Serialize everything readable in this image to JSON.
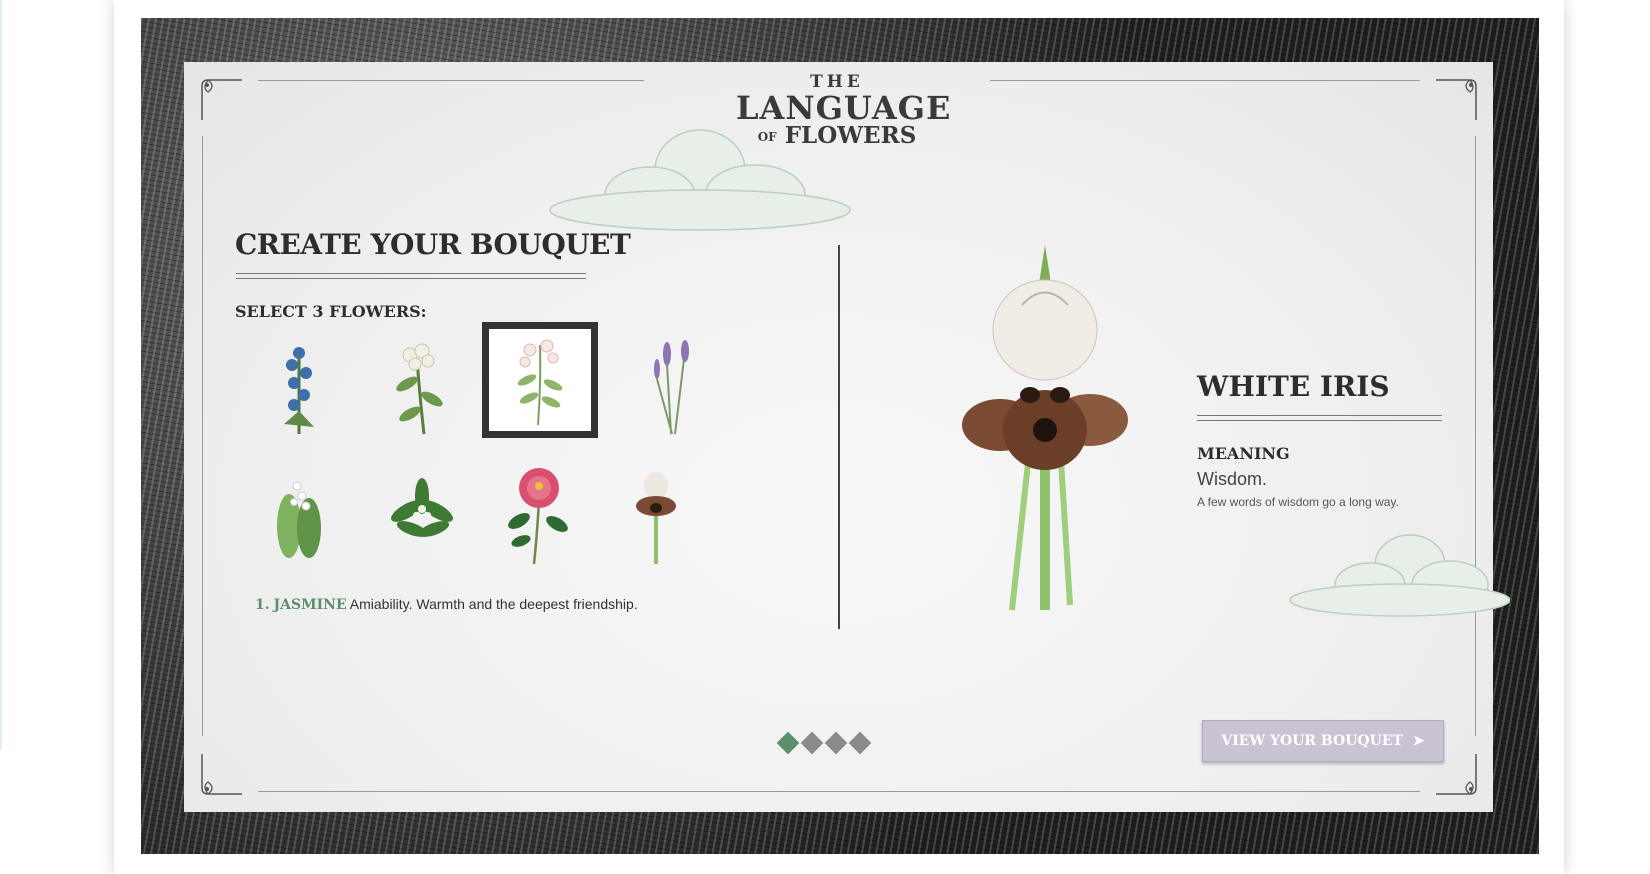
{
  "logo": {
    "line1": "THE",
    "line2": "LANGUAGE",
    "line3_small": "OF",
    "line3": "FLOWERS"
  },
  "builder": {
    "title": "CREATE YOUR BOUQUET",
    "subtitle": "SELECT 3 FLOWERS:",
    "flowers": [
      {
        "icon": "blue-larkspur-flower-icon",
        "selected": false
      },
      {
        "icon": "white-cluster-flower-icon",
        "selected": false
      },
      {
        "icon": "jasmine-flower-icon",
        "selected": true
      },
      {
        "icon": "lavender-flower-icon",
        "selected": false
      },
      {
        "icon": "lily-of-the-valley-flower-icon",
        "selected": false
      },
      {
        "icon": "green-leafy-flower-icon",
        "selected": false
      },
      {
        "icon": "pink-rose-flower-icon",
        "selected": false
      },
      {
        "icon": "white-iris-flower-icon",
        "selected": false
      }
    ],
    "status_number": "1.",
    "status_name": "JASMINE",
    "status_meaning": "Amiability. Warmth and the deepest friendship."
  },
  "detail": {
    "name": "WHITE IRIS",
    "meaning_label": "MEANING",
    "meaning": "Wisdom.",
    "description": "A few words of wisdom go a long way."
  },
  "pagination": {
    "total": 4,
    "active": 1
  },
  "cta": {
    "label": "VIEW YOUR BOUQUET",
    "arrow": "➤"
  },
  "colors": {
    "accent_green": "#5c8f6c",
    "button_lavender": "#c9c3d3",
    "text_dark": "#2d2d2d"
  }
}
